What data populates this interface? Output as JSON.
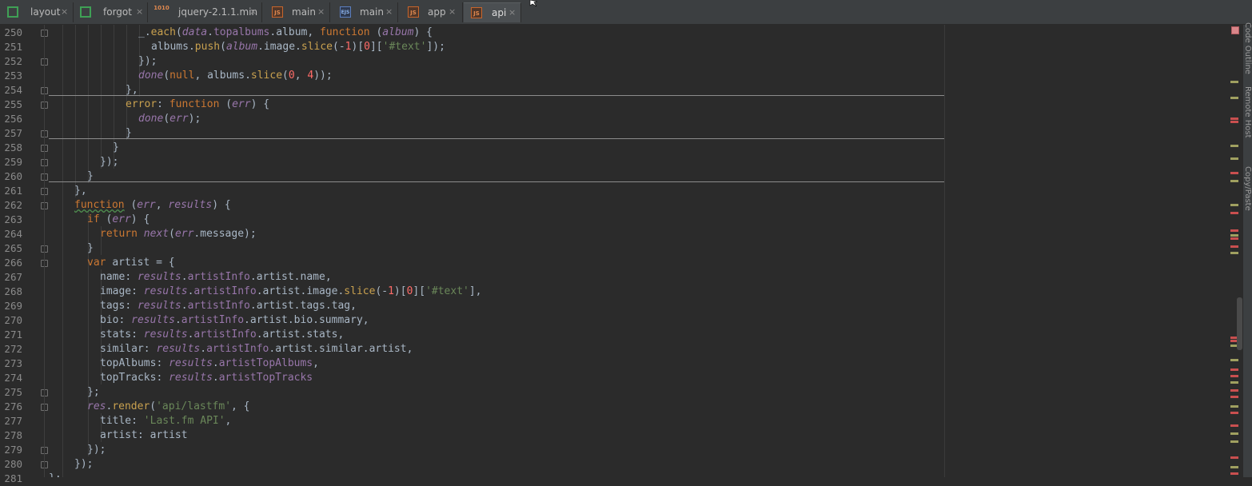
{
  "tabs": [
    {
      "label": "layout",
      "icon": "html-file-icon",
      "close": "×"
    },
    {
      "label": "forgot",
      "icon": "html-file-icon",
      "close": "×"
    },
    {
      "label": "jquery-2.1.1.min",
      "icon": "minified-js-file-icon",
      "close": "×"
    },
    {
      "label": "main",
      "icon": "js-file-icon",
      "close": "×"
    },
    {
      "label": "main",
      "icon": "ejs-file-icon",
      "close": "×"
    },
    {
      "label": "app",
      "icon": "js-file-icon",
      "close": "×"
    },
    {
      "label": "api",
      "icon": "js-file-icon",
      "close": "×"
    }
  ],
  "active_tab": "api",
  "icon_glyphs": {
    "js": "JS",
    "ejs": "EJS",
    "min": "1010"
  },
  "line_numbers": [
    "250",
    "251",
    "252",
    "253",
    "254",
    "255",
    "256",
    "257",
    "258",
    "259",
    "260",
    "261",
    "262",
    "263",
    "264",
    "265",
    "266",
    "267",
    "268",
    "269",
    "270",
    "271",
    "272",
    "273",
    "274",
    "275",
    "276",
    "277",
    "278",
    "279",
    "280",
    "281"
  ],
  "code_lines": [
    "_.each(data.topalbums.album, function (album) {",
    "albums.push(album.image.slice(-1)[0]['#text']);",
    "});",
    "done(null, albums.slice(0, 4));",
    "},",
    "error: function (err) {",
    "done(err);",
    "}",
    "}",
    "});",
    "}",
    "},",
    "function (err, results) {",
    "if (err) {",
    "return next(err.message);",
    "}",
    "var artist = {",
    "name: results.artistInfo.artist.name,",
    "image: results.artistInfo.artist.image.slice(-1)[0]['#text'],",
    "tags: results.artistInfo.artist.tags.tag,",
    "bio: results.artistInfo.artist.bio.summary,",
    "stats: results.artistInfo.artist.stats,",
    "similar: results.artistInfo.artist.similar.artist,",
    "topAlbums: results.artistTopAlbums,",
    "topTracks: results.artistTopTracks",
    "};",
    "res.render('api/lastfm', {",
    "title: 'Last.fm API',",
    "artist: artist",
    "});",
    "});",
    "};"
  ],
  "side_panels": [
    "Code Outline",
    "Remote Host",
    "Copy/Paste"
  ],
  "colors": {
    "keyword": "#cc7832",
    "function": "#ffc66d",
    "string": "#6a8759",
    "number": "#ff6b68",
    "param": "#9876aa",
    "text": "#a9b7c6",
    "background": "#2b2b2b"
  }
}
